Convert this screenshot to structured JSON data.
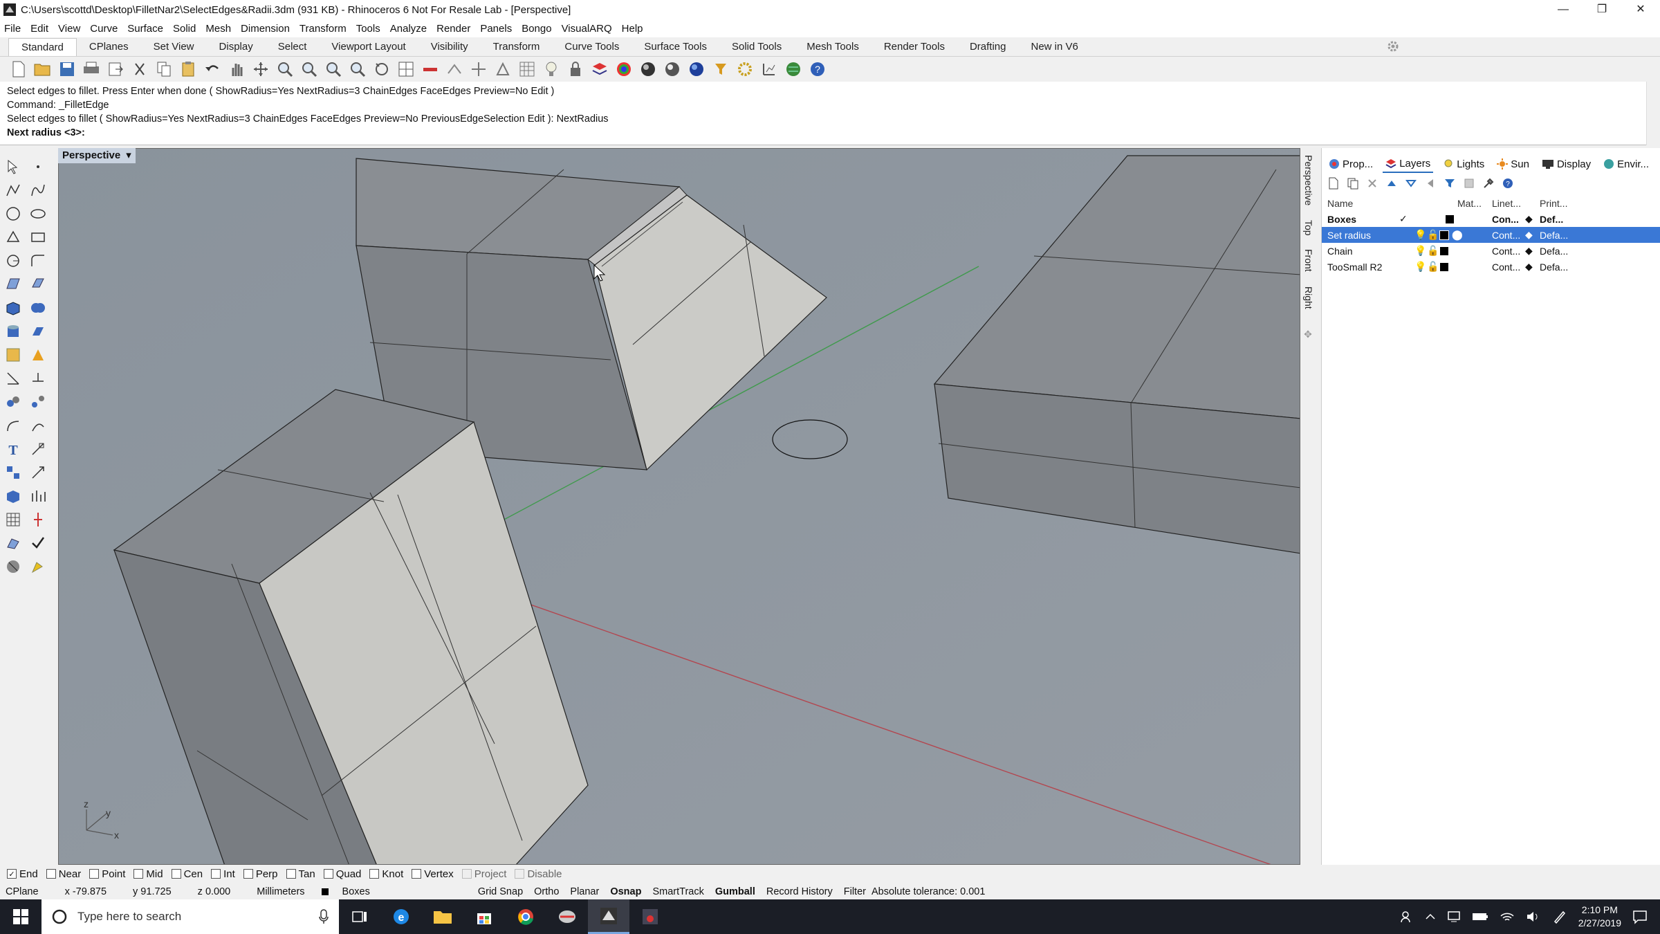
{
  "window": {
    "title": "C:\\Users\\scottd\\Desktop\\FilletNar2\\SelectEdges&Radii.3dm (931 KB) - Rhinoceros 6 Not For Resale Lab - [Perspective]",
    "minimize": "—",
    "restore": "❐",
    "close": "✕"
  },
  "menu": [
    "File",
    "Edit",
    "View",
    "Curve",
    "Surface",
    "Solid",
    "Mesh",
    "Dimension",
    "Transform",
    "Tools",
    "Analyze",
    "Render",
    "Panels",
    "Bongo",
    "VisualARQ",
    "Help"
  ],
  "toolbar_tabs": [
    "Standard",
    "CPlanes",
    "Set View",
    "Display",
    "Select",
    "Viewport Layout",
    "Visibility",
    "Transform",
    "Curve Tools",
    "Surface Tools",
    "Solid Tools",
    "Mesh Tools",
    "Render Tools",
    "Drafting",
    "New in V6"
  ],
  "command_history": [
    "Select edges to fillet. Press Enter when done ( ShowRadius=Yes  NextRadius=3  ChainEdges  FaceEdges  Preview=No  Edit )",
    "Command: _FilletEdge",
    "Select edges to fillet ( ShowRadius=Yes  NextRadius=3  ChainEdges  FaceEdges  Preview=No  PreviousEdgeSelection  Edit ): NextRadius"
  ],
  "command_prompt": "Next radius <3>:",
  "viewport": {
    "label": "Perspective",
    "dropdown": "▾",
    "axis_z": "z",
    "axis_y": "y",
    "axis_x": "x"
  },
  "side_view_tabs": [
    "Perspective",
    "Top",
    "Front",
    "Right"
  ],
  "panel_tabs": [
    "Prop...",
    "Layers",
    "Lights",
    "Sun",
    "Display",
    "Envir..."
  ],
  "layers": {
    "headers": {
      "name": "Name",
      "material": "Mat...",
      "linetype": "Linet...",
      "print": "Print..."
    },
    "rows": [
      {
        "name": "Boxes",
        "current": "✓",
        "linetype": "Con...",
        "print": "Def...",
        "selected": false,
        "bold": true
      },
      {
        "name": "Set radius",
        "current": "",
        "linetype": "Cont...",
        "print": "Defa...",
        "selected": true,
        "bold": false
      },
      {
        "name": "Chain",
        "current": "",
        "linetype": "Cont...",
        "print": "Defa...",
        "selected": false,
        "bold": false
      },
      {
        "name": "TooSmall R2",
        "current": "",
        "linetype": "Cont...",
        "print": "Defa...",
        "selected": false,
        "bold": false
      }
    ]
  },
  "osnaps": [
    {
      "label": "End",
      "checked": true,
      "disabled": false
    },
    {
      "label": "Near",
      "checked": false,
      "disabled": false
    },
    {
      "label": "Point",
      "checked": false,
      "disabled": false
    },
    {
      "label": "Mid",
      "checked": false,
      "disabled": false
    },
    {
      "label": "Cen",
      "checked": false,
      "disabled": false
    },
    {
      "label": "Int",
      "checked": false,
      "disabled": false
    },
    {
      "label": "Perp",
      "checked": false,
      "disabled": false
    },
    {
      "label": "Tan",
      "checked": false,
      "disabled": false
    },
    {
      "label": "Quad",
      "checked": false,
      "disabled": false
    },
    {
      "label": "Knot",
      "checked": false,
      "disabled": false
    },
    {
      "label": "Vertex",
      "checked": false,
      "disabled": false
    },
    {
      "label": "Project",
      "checked": false,
      "disabled": true
    },
    {
      "label": "Disable",
      "checked": false,
      "disabled": true
    }
  ],
  "status": {
    "cplane": "CPlane",
    "x": "x -79.875",
    "y": "y 91.725",
    "z": "z 0.000",
    "units": "Millimeters",
    "layer": "Boxes",
    "grid_snap": "Grid Snap",
    "ortho": "Ortho",
    "planar": "Planar",
    "osnap": "Osnap",
    "smarttrack": "SmartTrack",
    "gumball": "Gumball",
    "record_history": "Record History",
    "filter": "Filter",
    "tolerance": "Absolute tolerance: 0.001"
  },
  "taskbar": {
    "search_placeholder": "Type here to search",
    "time": "2:10 PM",
    "date": "2/27/2019"
  },
  "colors": {
    "viewport_bg": "#8e969f",
    "selection": "#3a78d6",
    "taskbar": "#1b1e26",
    "x_axis": "#b3464f",
    "y_axis": "#3f9a4c"
  }
}
